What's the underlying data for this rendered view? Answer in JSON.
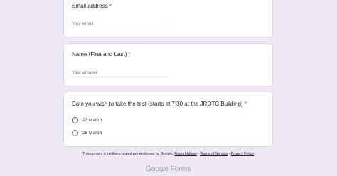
{
  "questions": [
    {
      "title": "Email address",
      "required_mark": "*",
      "placeholder": "Your email"
    },
    {
      "title": "Name (First and Last)",
      "required_mark": "*",
      "placeholder": "Your answer"
    },
    {
      "title": "Date you wish to take the test (starts at 7:30 at the JROTC Building)",
      "required_mark": "*",
      "options": [
        "23 March",
        "25 March"
      ]
    }
  ],
  "footer": {
    "disclaimer": "This content is neither created nor endorsed by Google.",
    "separator": "-",
    "links": [
      "Report Abuse",
      "Terms of Service",
      "Privacy Policy"
    ]
  },
  "logo": {
    "google": "Google",
    "forms": "Forms"
  }
}
